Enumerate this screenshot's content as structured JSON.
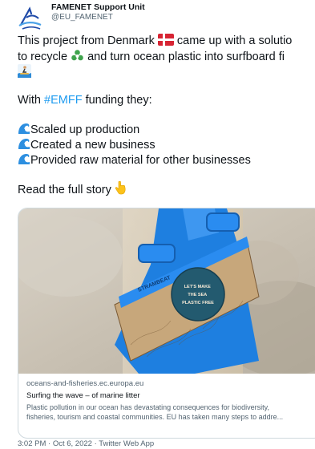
{
  "author": {
    "display_name": "FAMENET Support Unit",
    "handle": "@EU_FAMENET",
    "avatar_icon": "famenet-logo-icon"
  },
  "tweet": {
    "line1_pre": "This project from Denmark ",
    "line1_post": " came up with a solutio",
    "line2_pre": "to recycle ",
    "line2_post": " and turn ocean plastic into surfboard fi",
    "line4_pre": "With ",
    "hashtag": "#EMFF",
    "line4_post": " funding they:",
    "bullets": [
      "Scaled up production",
      "Created a new business",
      "Provided raw material for other businesses"
    ],
    "read_more": "Read the full story "
  },
  "emoji_icons": [
    "denmark-flag-icon",
    "recycle-icon",
    "surfer-icon",
    "wave-icon",
    "pointing-down-icon"
  ],
  "link_card": {
    "image_text": "LET'S MAKE THE SEA PLASTIC FREE",
    "image_brand": "STRAMBEAT",
    "domain": "oceans-and-fisheries.ec.europa.eu",
    "title": "Surfing the wave – of marine litter",
    "description_line1": "Plastic pollution in our ocean has devastating consequences for biodiversity,",
    "description_line2": "fisheries, tourism and coastal communities. EU has taken many steps to addre..."
  },
  "timestamp": "3:02 PM · Oct 6, 2022 · Twitter Web App",
  "colors": {
    "link_blue": "#1d9bf0",
    "text": "#0f1419",
    "muted": "#536471",
    "fin_blue": "#1e7fe0"
  }
}
